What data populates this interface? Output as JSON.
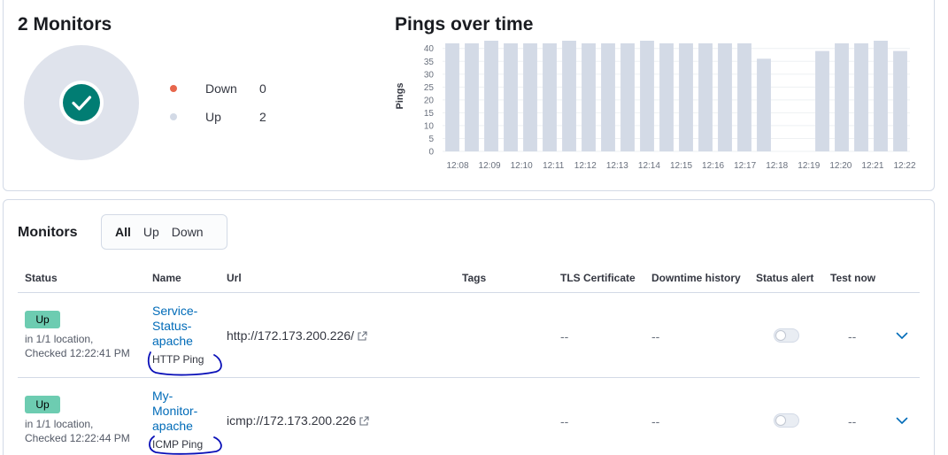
{
  "summary": {
    "title": "2 Monitors",
    "legend": [
      {
        "label": "Down",
        "count": "0",
        "color": "#e7664c"
      },
      {
        "label": "Up",
        "count": "2",
        "color": "#d3dae6"
      }
    ]
  },
  "pings": {
    "title": "Pings over time"
  },
  "chart_data": {
    "type": "bar",
    "title": "Pings over time",
    "ylabel": "Pings",
    "xlabel": "",
    "ylim": [
      0,
      43
    ],
    "yticks": [
      "0",
      "5",
      "10",
      "15",
      "20",
      "25",
      "30",
      "35",
      "40"
    ],
    "x_tick_labels": [
      "12:08",
      "12:09",
      "12:10",
      "12:11",
      "12:12",
      "12:13",
      "12:14",
      "12:15",
      "12:16",
      "12:17",
      "12:18",
      "12:19",
      "12:20",
      "12:21",
      "12:22"
    ],
    "values": [
      42,
      42,
      43,
      42,
      42,
      42,
      43,
      42,
      42,
      42,
      43,
      42,
      42,
      42,
      42,
      42,
      36,
      0,
      0,
      39,
      42,
      42,
      43,
      39
    ],
    "grid": true,
    "color": "#d3dae6"
  },
  "monitors": {
    "title": "Monitors",
    "filters": [
      "All",
      "Up",
      "Down"
    ],
    "columns": {
      "status": "Status",
      "name": "Name",
      "url": "Url",
      "tags": "Tags",
      "tls": "TLS Certificate",
      "downtime": "Downtime history",
      "alert": "Status alert",
      "test": "Test now"
    },
    "rows": [
      {
        "status": "Up",
        "location": "in 1/1 location,",
        "checked": "Checked 12:22:41 PM",
        "name": "Service-Status-apache",
        "type": "HTTP Ping",
        "url": "http://172.173.200.226/",
        "tls": "--",
        "downtime": "--",
        "test": "--"
      },
      {
        "status": "Up",
        "location": "in 1/1 location,",
        "checked": "Checked 12:22:44 PM",
        "name": "My-Monitor-apache",
        "type": "ICMP Ping",
        "url": "icmp://172.173.200.226",
        "tls": "--",
        "downtime": "--",
        "test": "--"
      }
    ]
  }
}
